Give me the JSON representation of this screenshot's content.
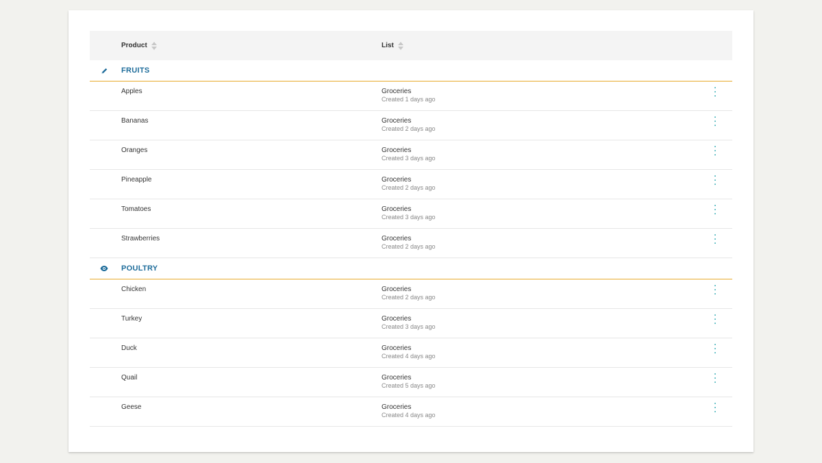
{
  "table": {
    "columns": {
      "product": "Product",
      "list": "List"
    },
    "groups": [
      {
        "title": "FRUITS",
        "icon": "pencil-icon",
        "rows": [
          {
            "product": "Apples",
            "list": "Groceries",
            "created": "Created 1 days ago"
          },
          {
            "product": "Bananas",
            "list": "Groceries",
            "created": "Created 2 days ago"
          },
          {
            "product": "Oranges",
            "list": "Groceries",
            "created": "Created 3 days ago"
          },
          {
            "product": "Pineapple",
            "list": "Groceries",
            "created": "Created 2 days ago"
          },
          {
            "product": "Tomatoes",
            "list": "Groceries",
            "created": "Created 3 days ago"
          },
          {
            "product": "Strawberries",
            "list": "Groceries",
            "created": "Created 2 days ago"
          }
        ]
      },
      {
        "title": "POULTRY",
        "icon": "eye-icon",
        "rows": [
          {
            "product": "Chicken",
            "list": "Groceries",
            "created": "Created 2 days ago"
          },
          {
            "product": "Turkey",
            "list": "Groceries",
            "created": "Created 3 days ago"
          },
          {
            "product": "Duck",
            "list": "Groceries",
            "created": "Created 4 days ago"
          },
          {
            "product": "Quail",
            "list": "Groceries",
            "created": "Created 5 days ago"
          },
          {
            "product": "Geese",
            "list": "Groceries",
            "created": "Created 4 days ago"
          }
        ]
      }
    ]
  },
  "colors": {
    "group_title": "#1f6d9b",
    "group_divider": "#e8a92a",
    "kebab": "#3fb0b8"
  }
}
